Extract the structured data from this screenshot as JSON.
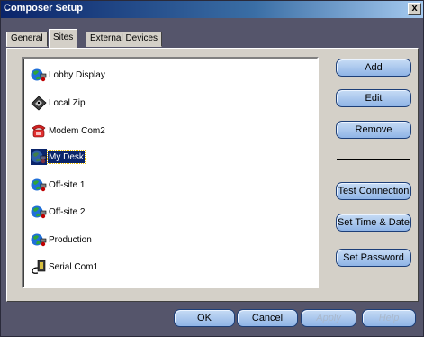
{
  "window": {
    "title": "Composer Setup",
    "close_glyph": "x"
  },
  "tabs": [
    {
      "label": "General",
      "active": false
    },
    {
      "label": "Sites",
      "active": true
    },
    {
      "label": "External Devices",
      "active": false
    }
  ],
  "sites": [
    {
      "label": "Lobby Display",
      "icon": "globe-network-icon",
      "selected": false
    },
    {
      "label": "Local Zip",
      "icon": "zip-disk-icon",
      "selected": false
    },
    {
      "label": "Modem Com2",
      "icon": "telephone-modem-icon",
      "selected": false
    },
    {
      "label": "My Desk",
      "icon": "globe-network-icon",
      "selected": true
    },
    {
      "label": "Off-site 1",
      "icon": "globe-network-icon",
      "selected": false
    },
    {
      "label": "Off-site 2",
      "icon": "globe-network-icon",
      "selected": false
    },
    {
      "label": "Production",
      "icon": "globe-network-icon",
      "selected": false
    },
    {
      "label": "Serial Com1",
      "icon": "serial-cable-icon",
      "selected": false
    }
  ],
  "side_buttons": {
    "add": "Add",
    "edit": "Edit",
    "remove": "Remove",
    "test_connection": "Test Connection",
    "set_time_date": "Set Time & Date",
    "set_password": "Set Password"
  },
  "footer_buttons": {
    "ok": "OK",
    "cancel": "Cancel",
    "apply": "Apply",
    "help": "Help"
  },
  "colors": {
    "title_bar": "#0a246a",
    "frame": "#55556b",
    "panel": "#d4d0c8",
    "button": "#a9c6ee",
    "selection": "#0a246a"
  }
}
